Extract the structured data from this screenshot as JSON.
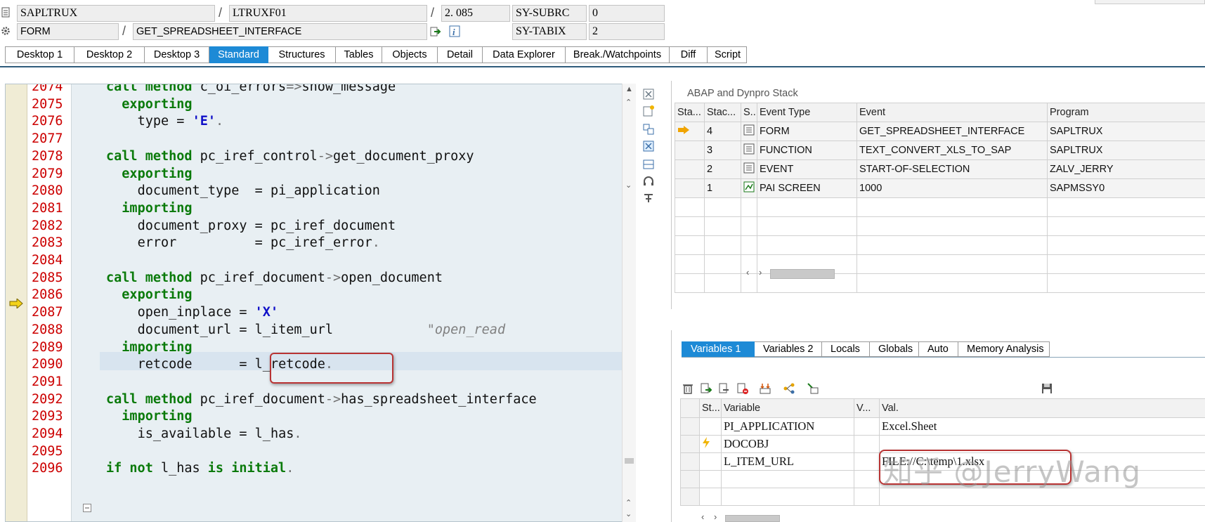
{
  "header": {
    "program": "SAPLTRUX",
    "include": "LTRUXF01",
    "line": "2. 085",
    "subrc_label": "SY-SUBRC",
    "subrc_value": "0",
    "event_type": "FORM",
    "event_name": "GET_SPREADSHEET_INTERFACE",
    "tabix_label": "SY-TABIX",
    "tabix_value": "2"
  },
  "desktop_tabs": [
    "Desktop 1",
    "Desktop 2",
    "Desktop 3",
    "Standard",
    "Structures",
    "Tables",
    "Objects",
    "Detail",
    "Data Explorer",
    "Break./Watchpoints",
    "Diff",
    "Script"
  ],
  "active_desktop_tab": "Standard",
  "code": {
    "line_numbers": [
      "2074",
      "2075",
      "2076",
      "2077",
      "2078",
      "2079",
      "2080",
      "2081",
      "2082",
      "2083",
      "2084",
      "2085",
      "2086",
      "2087",
      "2088",
      "2089",
      "2090",
      "2091",
      "2092",
      "2093",
      "2094",
      "2095",
      "2096"
    ],
    "current_line": "2085",
    "comment": "\"open_read"
  },
  "stack": {
    "title": "ABAP and Dynpro Stack",
    "columns": [
      "Sta...",
      "Stac...",
      "S...",
      "Event Type",
      "Event",
      "Program"
    ],
    "rows": [
      {
        "level": "4",
        "event_type": "FORM",
        "event": "GET_SPREADSHEET_INTERFACE",
        "program": "SAPLTRUX",
        "current": true
      },
      {
        "level": "3",
        "event_type": "FUNCTION",
        "event": "TEXT_CONVERT_XLS_TO_SAP",
        "program": "SAPLTRUX",
        "current": false
      },
      {
        "level": "2",
        "event_type": "EVENT",
        "event": "START-OF-SELECTION",
        "program": "ZALV_JERRY",
        "current": false
      },
      {
        "level": "1",
        "event_type": "PAI SCREEN",
        "event": "1000",
        "program": "SAPMSSY0",
        "current": false
      }
    ]
  },
  "variables": {
    "tabs": [
      "Variables 1",
      "Variables 2",
      "Locals",
      "Globals",
      "Auto",
      "Memory Analysis"
    ],
    "active_tab": "Variables 1",
    "columns": [
      "St...",
      "Variable",
      "V...",
      "Val."
    ],
    "rows": [
      {
        "name": "PI_APPLICATION",
        "value": "Excel.Sheet"
      },
      {
        "name": "DOCOBJ",
        "value": ""
      },
      {
        "name": "L_ITEM_URL",
        "value": "FILE://C:\\temp\\1.xlsx"
      }
    ]
  },
  "watermark": "知乎 @JerryWang",
  "colors": {
    "accent": "#1d8ad6",
    "keyword": "#0a7a0a",
    "linenumber": "#cc0000",
    "string": "#1010c8",
    "highlight": "#b83333"
  }
}
